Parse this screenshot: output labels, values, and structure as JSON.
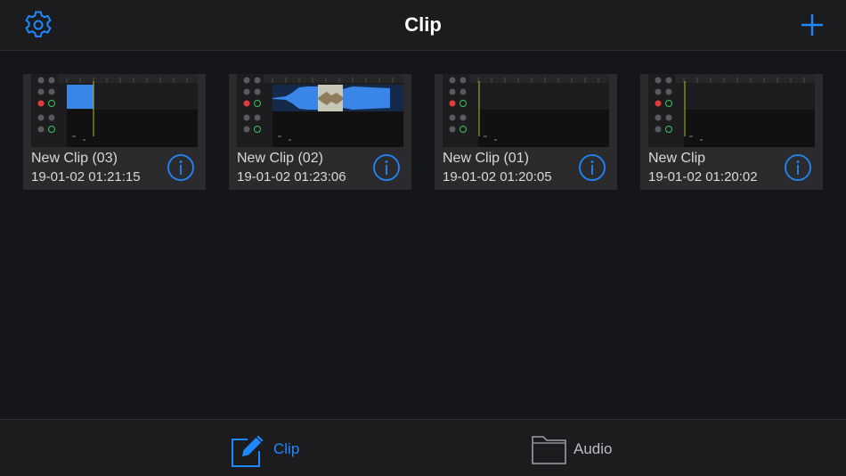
{
  "app": {
    "title": "Clip",
    "accent_color": "#1e88ff"
  },
  "navbar": {
    "title": "Clip",
    "left_icon": "gear-icon",
    "right_icon": "plus-icon"
  },
  "clips": [
    {
      "name": "New Clip (03)",
      "date": "19-01-02 01:21:15",
      "info_icon": "info-icon"
    },
    {
      "name": "New Clip (02)",
      "date": "19-01-02 01:23:06",
      "info_icon": "info-icon"
    },
    {
      "name": "New Clip (01)",
      "date": "19-01-02 01:20:05",
      "info_icon": "info-icon"
    },
    {
      "name": "New Clip",
      "date": "19-01-02 01:20:02",
      "info_icon": "info-icon"
    }
  ],
  "tabbar": {
    "tabs": [
      {
        "label": "Clip",
        "icon": "edit-icon",
        "selected": true
      },
      {
        "label": "Audio",
        "icon": "folder-icon",
        "selected": false
      }
    ]
  }
}
